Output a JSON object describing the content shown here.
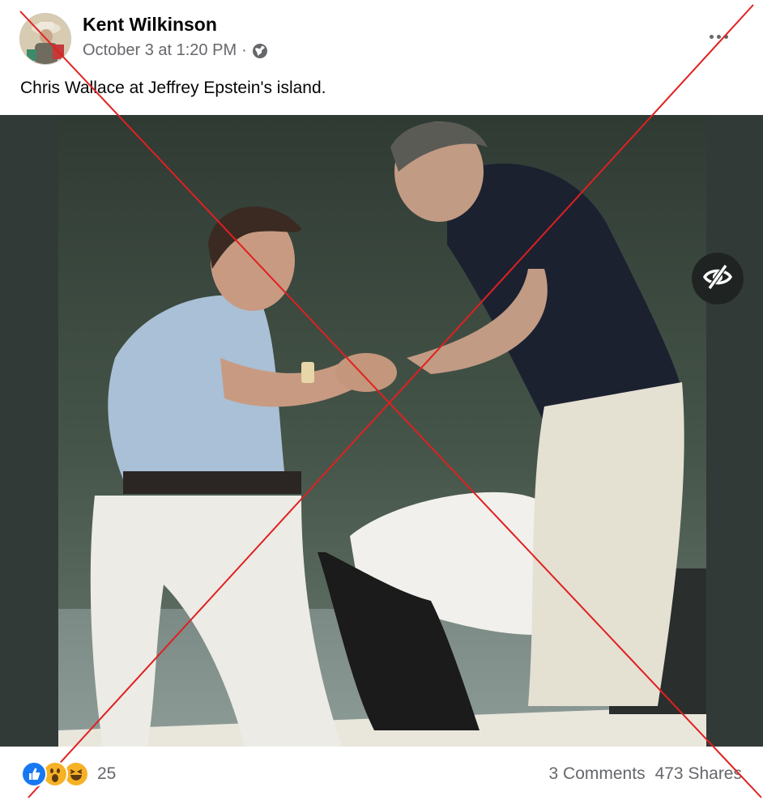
{
  "post": {
    "author": "Kent Wilkinson",
    "date": "October 3 at 1:20 PM",
    "separator": "·",
    "privacy_icon": "globe-icon",
    "caption": "Chris Wallace at Jeffrey Epstein's island."
  },
  "media": {
    "hide_icon": "eye-slash-icon"
  },
  "footer": {
    "reaction_icons": [
      "like-icon",
      "wow-icon",
      "haha-icon"
    ],
    "reaction_count": "25",
    "comments": "3 Comments",
    "shares": "473 Shares"
  },
  "colors": {
    "secondary_text": "#65676b",
    "like_blue": "#1877f2",
    "reaction_yellow": "#f7b125",
    "cross_red": "#e02020"
  }
}
